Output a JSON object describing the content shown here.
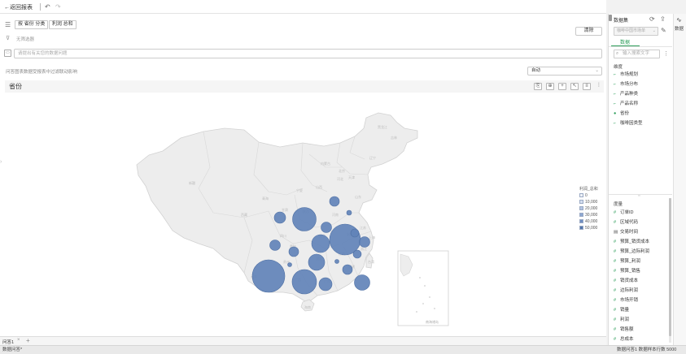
{
  "toolbar": {
    "back_label": "←返回报表"
  },
  "query": {
    "chip_dims": "按 省份 分类",
    "chip_measure": "利润 总和",
    "clear_label": "清除",
    "no_filter": "无筛选器",
    "ask_placeholder": "请提出有关您的数据问题",
    "hint": "问答图表数据受报表中过滤联动影响",
    "auto_select": "自动"
  },
  "chart": {
    "title": "省份",
    "legend_title": "利润_总和",
    "legend_items": [
      "0",
      "10,000",
      "20,000",
      "30,000",
      "40,000",
      "50,000"
    ],
    "map_labels": [
      "黑龙江",
      "吉林",
      "辽宁",
      "内蒙古",
      "新疆",
      "西藏",
      "青海",
      "甘肃",
      "宁夏",
      "四川",
      "山西",
      "河北",
      "山东",
      "河南",
      "陕西",
      "云南",
      "贵州",
      "湖南",
      "广西",
      "广东",
      "海南",
      "福建",
      "浙江",
      "江苏",
      "安徽",
      "湖北",
      "江西",
      "重庆",
      "北京",
      "天津",
      "上海",
      "台湾"
    ],
    "inset_label": "南海诸岛",
    "accent": "#5b7fb5"
  },
  "tabs": {
    "active": "问答1",
    "add": "+"
  },
  "status": {
    "left": "数据问答*",
    "right": "数据问答1   数据样本行数 5000"
  },
  "right_panel": {
    "header": "数据集",
    "dataset_name": "咖啡中国市场单",
    "tab_data": "数据",
    "search_placeholder": "输入搜索文字",
    "dims_title": "维度",
    "dimensions": [
      "市场规划",
      "市场分布",
      "产品种类",
      "产品名称",
      "省份",
      "咖啡因类型"
    ],
    "measures_title": "度量",
    "measures": [
      "订单ID",
      "区域代码",
      "交易时间",
      "预算_销货成本",
      "预算_边际利润",
      "预算_利润",
      "预算_销售",
      "销货成本",
      "边际利润",
      "市场开销",
      "销量",
      "利润",
      "销售额",
      "总成本"
    ],
    "strip_label": "数据"
  }
}
